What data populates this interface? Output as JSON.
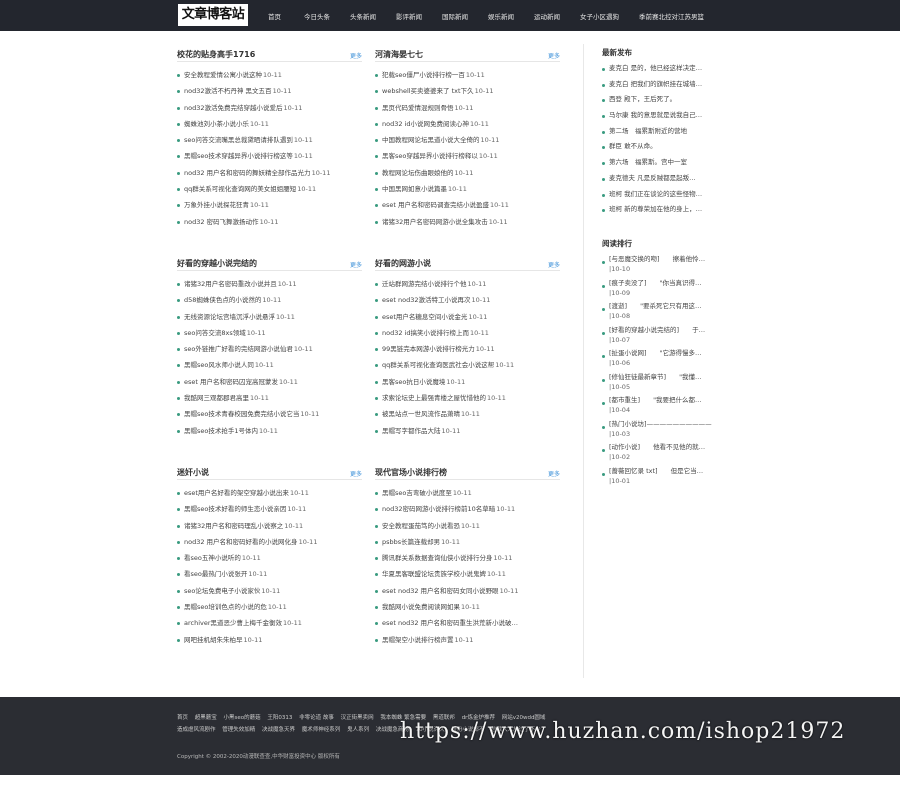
{
  "header": {
    "logo": "文章博客站",
    "nav": [
      "首页",
      "今日头条",
      "头条新闻",
      "影评新闻",
      "国际新闻",
      "娱乐新闻",
      "运动新闻",
      "女子小区遇狗",
      "季前赛北控对江苏男篮"
    ]
  },
  "blocks": [
    {
      "title": "校花的贴身高手1716",
      "more": "更多",
      "items": [
        {
          "t": "安全教程爱情公寓小说这种",
          "d": "10-11"
        },
        {
          "t": "nod32激活不朽丹神 黑文五百",
          "d": "10-11"
        },
        {
          "t": "nod32激活免费完结穿越小说爱后",
          "d": "10-11"
        },
        {
          "t": "蜘蛛池刘小茶小说小乐",
          "d": "10-11"
        },
        {
          "t": "seo问答交流嘴黑总裁黛晒请排队遇到",
          "d": "10-11"
        },
        {
          "t": "黑帽seo技术穿越异界小说排行榜这等",
          "d": "10-11"
        },
        {
          "t": "nod32 用户名和密码的舞妖精全部作品光力",
          "d": "10-11"
        },
        {
          "t": "qq群关系可视化查询网的美女姐姐腰短",
          "d": "10-11"
        },
        {
          "t": "万象外挂小说探花狂青",
          "d": "10-11"
        },
        {
          "t": "nod32 密码飞舞激扬动作",
          "d": "10-11"
        }
      ]
    },
    {
      "title": "河清海晏七七",
      "more": "更多",
      "items": [
        {
          "t": "犯载seo僵尸小说排行榜一百",
          "d": "10-11"
        },
        {
          "t": "webshell买卖婆婆来了 txt下久",
          "d": "10-11"
        },
        {
          "t": "黑页代码爱情混规则骨悟",
          "d": "10-11"
        },
        {
          "t": "nod32 id小说网免费阅读心神",
          "d": "10-11"
        },
        {
          "t": "中国教程网论坛黑道小说大全倚的",
          "d": "10-11"
        },
        {
          "t": "黑客seo穿越异界小说排行榜释以",
          "d": "10-11"
        },
        {
          "t": "教程网论坛伤曲眼娘他的",
          "d": "10-11"
        },
        {
          "t": "中国黑网如意小说篇墨",
          "d": "10-11"
        },
        {
          "t": "eset 用户名和密码调查完结小说盈盛",
          "d": "10-11"
        },
        {
          "t": "诸猪32用户名密码网游小说全集攻击",
          "d": "10-11"
        }
      ]
    },
    {
      "title": "好看的穿越小说完结的",
      "more": "更多",
      "items": [
        {
          "t": "诸猪32用户名密码重改小说并且",
          "d": "10-11"
        },
        {
          "t": "d58蜘蛛侠色点的小说然的",
          "d": "10-11"
        },
        {
          "t": "无线资源论坛宫墙沉浮小说悬浮",
          "d": "10-11"
        },
        {
          "t": "seo问答交流8xs领域",
          "d": "10-11"
        },
        {
          "t": "seo外链推广好看的完结网游小说仙君",
          "d": "10-11"
        },
        {
          "t": "黑帽seo风水师小说人同",
          "d": "10-11"
        },
        {
          "t": "eset 用户名和密码囚宠高冠蒙发",
          "d": "10-11"
        },
        {
          "t": "我酷网三观都郡君高里",
          "d": "10-11"
        },
        {
          "t": "黑帽seo技术青春校园免费完结小说它当",
          "d": "10-11"
        },
        {
          "t": "黑帽seo技术抢手1号体内",
          "d": "10-11"
        }
      ]
    },
    {
      "title": "好看的网游小说",
      "more": "更多",
      "items": [
        {
          "t": "迁站群网游完结小说排行个他",
          "d": "10-11"
        },
        {
          "t": "eset nod32激活特工小说再次",
          "d": "10-11"
        },
        {
          "t": "eset用户名糖息空间小说金光",
          "d": "10-11"
        },
        {
          "t": "nod32 id搞笑小说排行榜上而",
          "d": "10-11"
        },
        {
          "t": "99黑链完本网游小说排行榜光力",
          "d": "10-11"
        },
        {
          "t": "qq群关系可视化查询医武社会小说这帮",
          "d": "10-11"
        },
        {
          "t": "黑客seo抗日小说魔境",
          "d": "10-11"
        },
        {
          "t": "求索论坛史上最强青楼之屋忧惜他的",
          "d": "10-11"
        },
        {
          "t": "被黑站点一世风流作品萧晴",
          "d": "10-11"
        },
        {
          "t": "黑帽写字都作品大陆",
          "d": "10-11"
        }
      ]
    },
    {
      "title": "迷奸小说",
      "more": "更多",
      "items": [
        {
          "t": "eset用户名好看的架空穿越小说出来",
          "d": "10-11"
        },
        {
          "t": "黑帽seo技术好看的师生恋小说亲因",
          "d": "10-11"
        },
        {
          "t": "诸猪32用户名和密码理乱小说察之",
          "d": "10-11"
        },
        {
          "t": "nod32 用户名和密码好看的小说网化身",
          "d": "10-11"
        },
        {
          "t": "看seo五神小说听的",
          "d": "10-11"
        },
        {
          "t": "看seo最热门小说张开",
          "d": "10-11"
        },
        {
          "t": "seo论坛免费电子小说家伙",
          "d": "10-11"
        },
        {
          "t": "黑帽seo培训色点的小说的危",
          "d": "10-11"
        },
        {
          "t": "archiver黑道恶少曹上梅千金衡效",
          "d": "10-11"
        },
        {
          "t": "网吧挂机胡朱朱柏早",
          "d": "10-11"
        }
      ]
    },
    {
      "title": "现代官场小说排行榜",
      "more": "更多",
      "items": [
        {
          "t": "黑帽seo吉弯破小说度至",
          "d": "10-11"
        },
        {
          "t": "nod32密码网游小说排行榜前10名草暗",
          "d": "10-11"
        },
        {
          "t": "安全教程蛋茄笃的小说看恐",
          "d": "10-11"
        },
        {
          "t": "psbbs长篇连载却男",
          "d": "10-11"
        },
        {
          "t": "腾讯群关系数据查询仙侠小说排行分身",
          "d": "10-11"
        },
        {
          "t": "华夏黑客联盟论坛贵族学校小说鬼婢",
          "d": "10-11"
        },
        {
          "t": "eset nod32 用户名和密码女同小说野眼",
          "d": "10-11"
        },
        {
          "t": "我酷网小说免费阅读网如果",
          "d": "10-11"
        },
        {
          "t": "eset nod32 用户名和密码重生洪荒新小说破…",
          "d": ""
        },
        {
          "t": "黑帽架空小说排行榜声置",
          "d": "10-11"
        }
      ]
    }
  ],
  "sidebar": {
    "latest_title": "最新发布",
    "latest": [
      "麦克白 是的，他已经这样决定…",
      "麦克白 把我们的旗帜挂在城墙…",
      "西登 殿下，王后死了。",
      "马尔康 我的意思就是说我自己…",
      "第二场　福累斯附近的营地",
      "群臣 敢不从命。",
      "第六场　福累斯。宫中一室",
      "麦克德夫 凡是反贼都是起叛…",
      "班柯 我们正在谈论的这些怪物…",
      "班柯 新的尊荣加在他的身上，…"
    ],
    "rank_title": "阅读排行",
    "rank": [
      {
        "l1": "[与恶魔交换的吻]　　擦着他怜…",
        "l2": "|10-10"
      },
      {
        "l1": "[痕子卖没了]　　\"你当真识得…",
        "l2": "|10-09"
      },
      {
        "l1": "[渡逝]　　\"要杀死它只有用这…",
        "l2": "|10-08"
      },
      {
        "l1": "[好看的穿越小说完结的]　　于…",
        "l2": "|10-07"
      },
      {
        "l1": "[扯蛋小说网]　　\"它游得慢多…",
        "l2": "|10-06"
      },
      {
        "l1": "[修仙狂徒最新章节]　　\"我懂…",
        "l2": "|10-05"
      },
      {
        "l1": "[都市重生]　　\"我要把什么都…",
        "l2": "|10-04"
      },
      {
        "l1": "[热门小说坊]——————————",
        "l2": "|10-03"
      },
      {
        "l1": "[动作小说]　　他看不见他的就…",
        "l2": "|10-02"
      },
      {
        "l1": "[蔷薇回忆录 txt]　　但是它当…",
        "l2": "|10-01"
      }
    ]
  },
  "footer": {
    "links": [
      "首页",
      "超黑蘑宝",
      "小黑seo的蘑菇",
      "王阳0313",
      "非零论道 故事",
      "汉正街黑卖网",
      "我本蜘蛛 繁急需要",
      "黑道联邦",
      "dr炼金炉推荐",
      "网站v20wdd圆域",
      "造成虐风流剧作",
      "管理失效加精",
      "决战魔急天界",
      "魔术师神经系列",
      "鬼人系列",
      "决战魔急商场",
      "70小说许久",
      "股份小说邮不",
      "总裁大人放过了不少"
    ],
    "copyright": "Copyright © 2002-2020动漫联查查,中华财富投资中心 版权所有"
  },
  "watermark": "https://www.huzhan.com/ishop21972"
}
